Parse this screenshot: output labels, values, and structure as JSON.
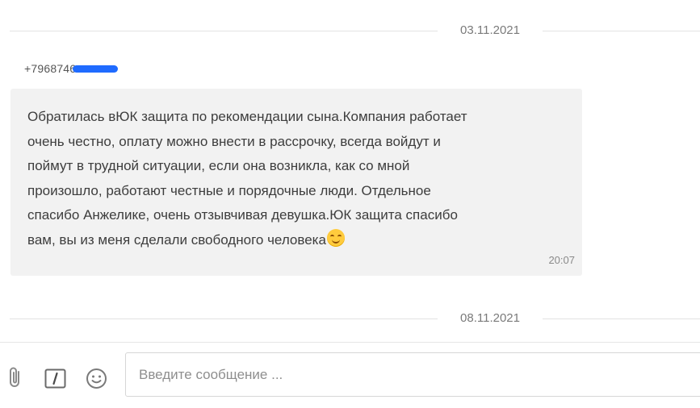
{
  "dates": {
    "first": "03.11.2021",
    "second": "08.11.2021"
  },
  "message": {
    "sender_visible": "+7968746",
    "sender_redaction_color": "#1f6bff",
    "lines": [
      "Обратилась вЮК защита по рекомендации сына.Компания работает",
      "очень честно, оплату можно внести в рассрочку, всегда войдут и",
      "поймут в трудной ситуации, если она возникла, как со мной",
      "произошло, работают честные и порядочные люди. Отдельное",
      "спасибо Анжелике, очень отзывчивая девушка.ЮК защита спасибо",
      "вам, вы из меня сделали свободного человека"
    ],
    "emoji": "smiling-face-emoji",
    "time": "20:07",
    "bubble_color": "#f2f2f2"
  },
  "composer": {
    "placeholder": "Введите сообщение ...",
    "value": "",
    "icons": [
      "paperclip-icon",
      "command-slash-icon",
      "smiley-icon"
    ]
  }
}
